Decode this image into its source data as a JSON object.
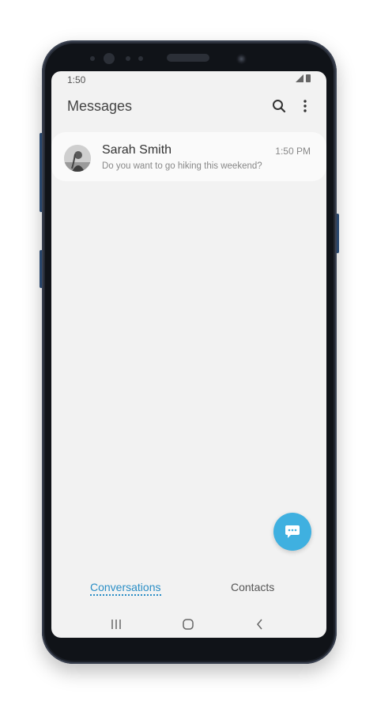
{
  "status_bar": {
    "time": "1:50"
  },
  "header": {
    "title": "Messages",
    "search_icon": "search-icon",
    "more_icon": "more-vertical-icon"
  },
  "conversations": [
    {
      "name": "Sarah Smith",
      "preview": "Do you want to go hiking this weekend?",
      "time": "1:50 PM"
    }
  ],
  "fab": {
    "icon": "new-message-icon",
    "color": "#3fb0e0"
  },
  "tabs": [
    {
      "label": "Conversations",
      "active": true
    },
    {
      "label": "Contacts",
      "active": false
    }
  ],
  "nav_bar": {
    "recents_icon": "recent-apps-icon",
    "home_icon": "home-icon",
    "back_icon": "back-icon"
  },
  "colors": {
    "accent": "#2a8ec6",
    "screen_background": "#f2f2f2"
  }
}
